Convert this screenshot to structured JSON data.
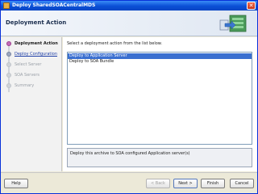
{
  "window": {
    "title": "Deploy SharedSOACentralMDS"
  },
  "header": {
    "title": "Deployment Action"
  },
  "sidebar": {
    "steps": [
      {
        "label": "Deployment Action",
        "state": "active"
      },
      {
        "label": "Deploy Configuration",
        "state": "link"
      },
      {
        "label": "Select Server",
        "state": "disabled"
      },
      {
        "label": "SOA Servers",
        "state": "disabled"
      },
      {
        "label": "Summary",
        "state": "disabled"
      }
    ]
  },
  "main": {
    "instruction": "Select a deployment action from the list below.",
    "actions": [
      {
        "label": "Deploy to Application Server",
        "selected": true
      },
      {
        "label": "Deploy to SOA Bundle",
        "selected": false
      }
    ],
    "description": "Deploy this archive to SOA configured Application server(s)"
  },
  "footer": {
    "help_label": "Help",
    "back_label": "< Back",
    "next_label": "Next >",
    "finish_label": "Finish",
    "cancel_label": "Cancel"
  },
  "colors": {
    "selection": "#3a6fd0",
    "titlebar": "#0a4fd6",
    "active_step": "#c46bb8"
  }
}
